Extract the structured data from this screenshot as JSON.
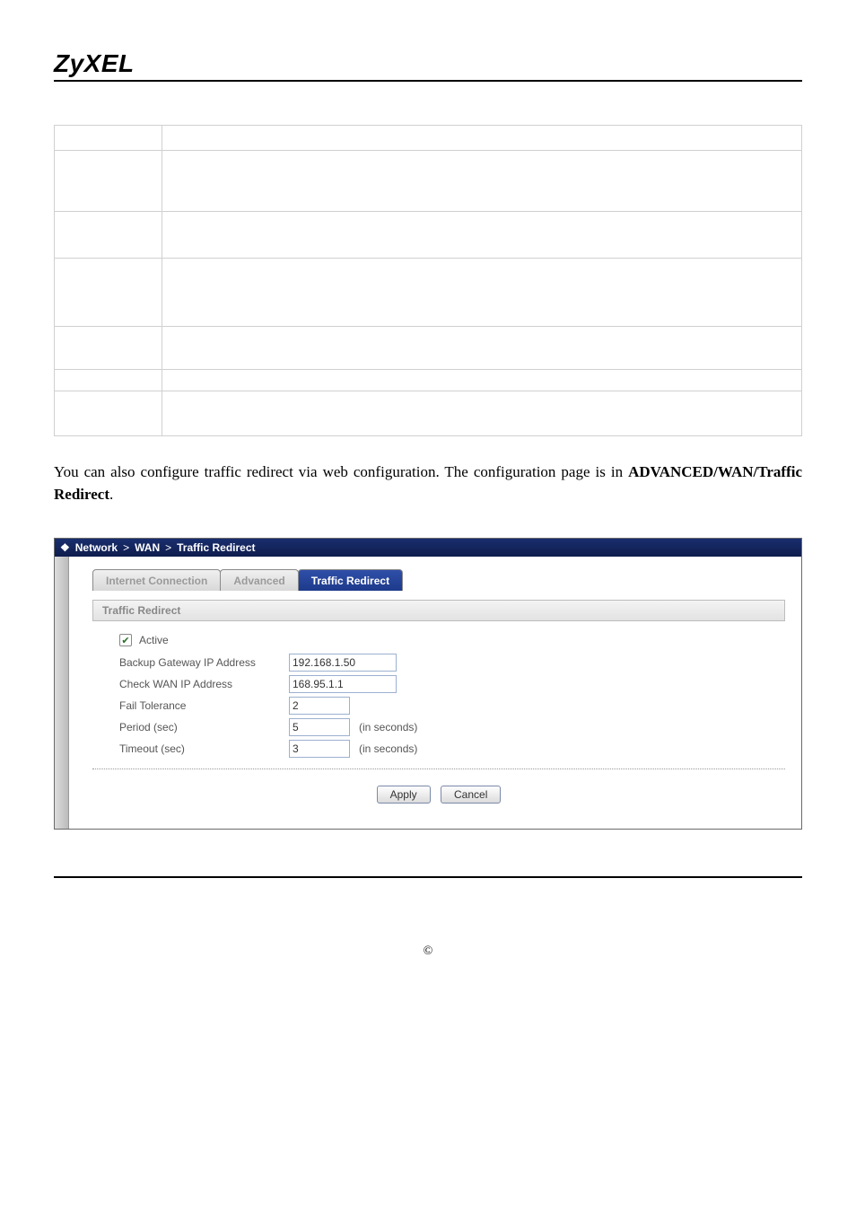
{
  "brand": "ZyXEL",
  "blank_table_row_heights": [
    28,
    68,
    52,
    76,
    48,
    24,
    50
  ],
  "paragraph": {
    "prefix": "You can also configure traffic redirect via web configuration. The configuration page is in ",
    "strong": "ADVANCED/WAN/Traffic Redirect",
    "suffix": "."
  },
  "breadcrumb": {
    "sep": ">",
    "items": [
      "Network",
      "WAN",
      "Traffic Redirect"
    ]
  },
  "tabs": {
    "inactive": [
      "Internet Connection",
      "Advanced"
    ],
    "active": "Traffic Redirect"
  },
  "section_title": "Traffic Redirect",
  "form": {
    "active_label": "Active",
    "active_checked": true,
    "backup_gateway": {
      "label": "Backup Gateway IP Address",
      "value": "192.168.1.50"
    },
    "check_wan": {
      "label": "Check WAN IP Address",
      "value": "168.95.1.1"
    },
    "fail_tolerance": {
      "label": "Fail Tolerance",
      "value": "2"
    },
    "period": {
      "label": "Period (sec)",
      "value": "5",
      "suffix": "(in seconds)"
    },
    "timeout": {
      "label": "Timeout (sec)",
      "value": "3",
      "suffix": "(in seconds)"
    }
  },
  "buttons": {
    "apply": "Apply",
    "cancel": "Cancel"
  },
  "copyright_symbol": "©"
}
